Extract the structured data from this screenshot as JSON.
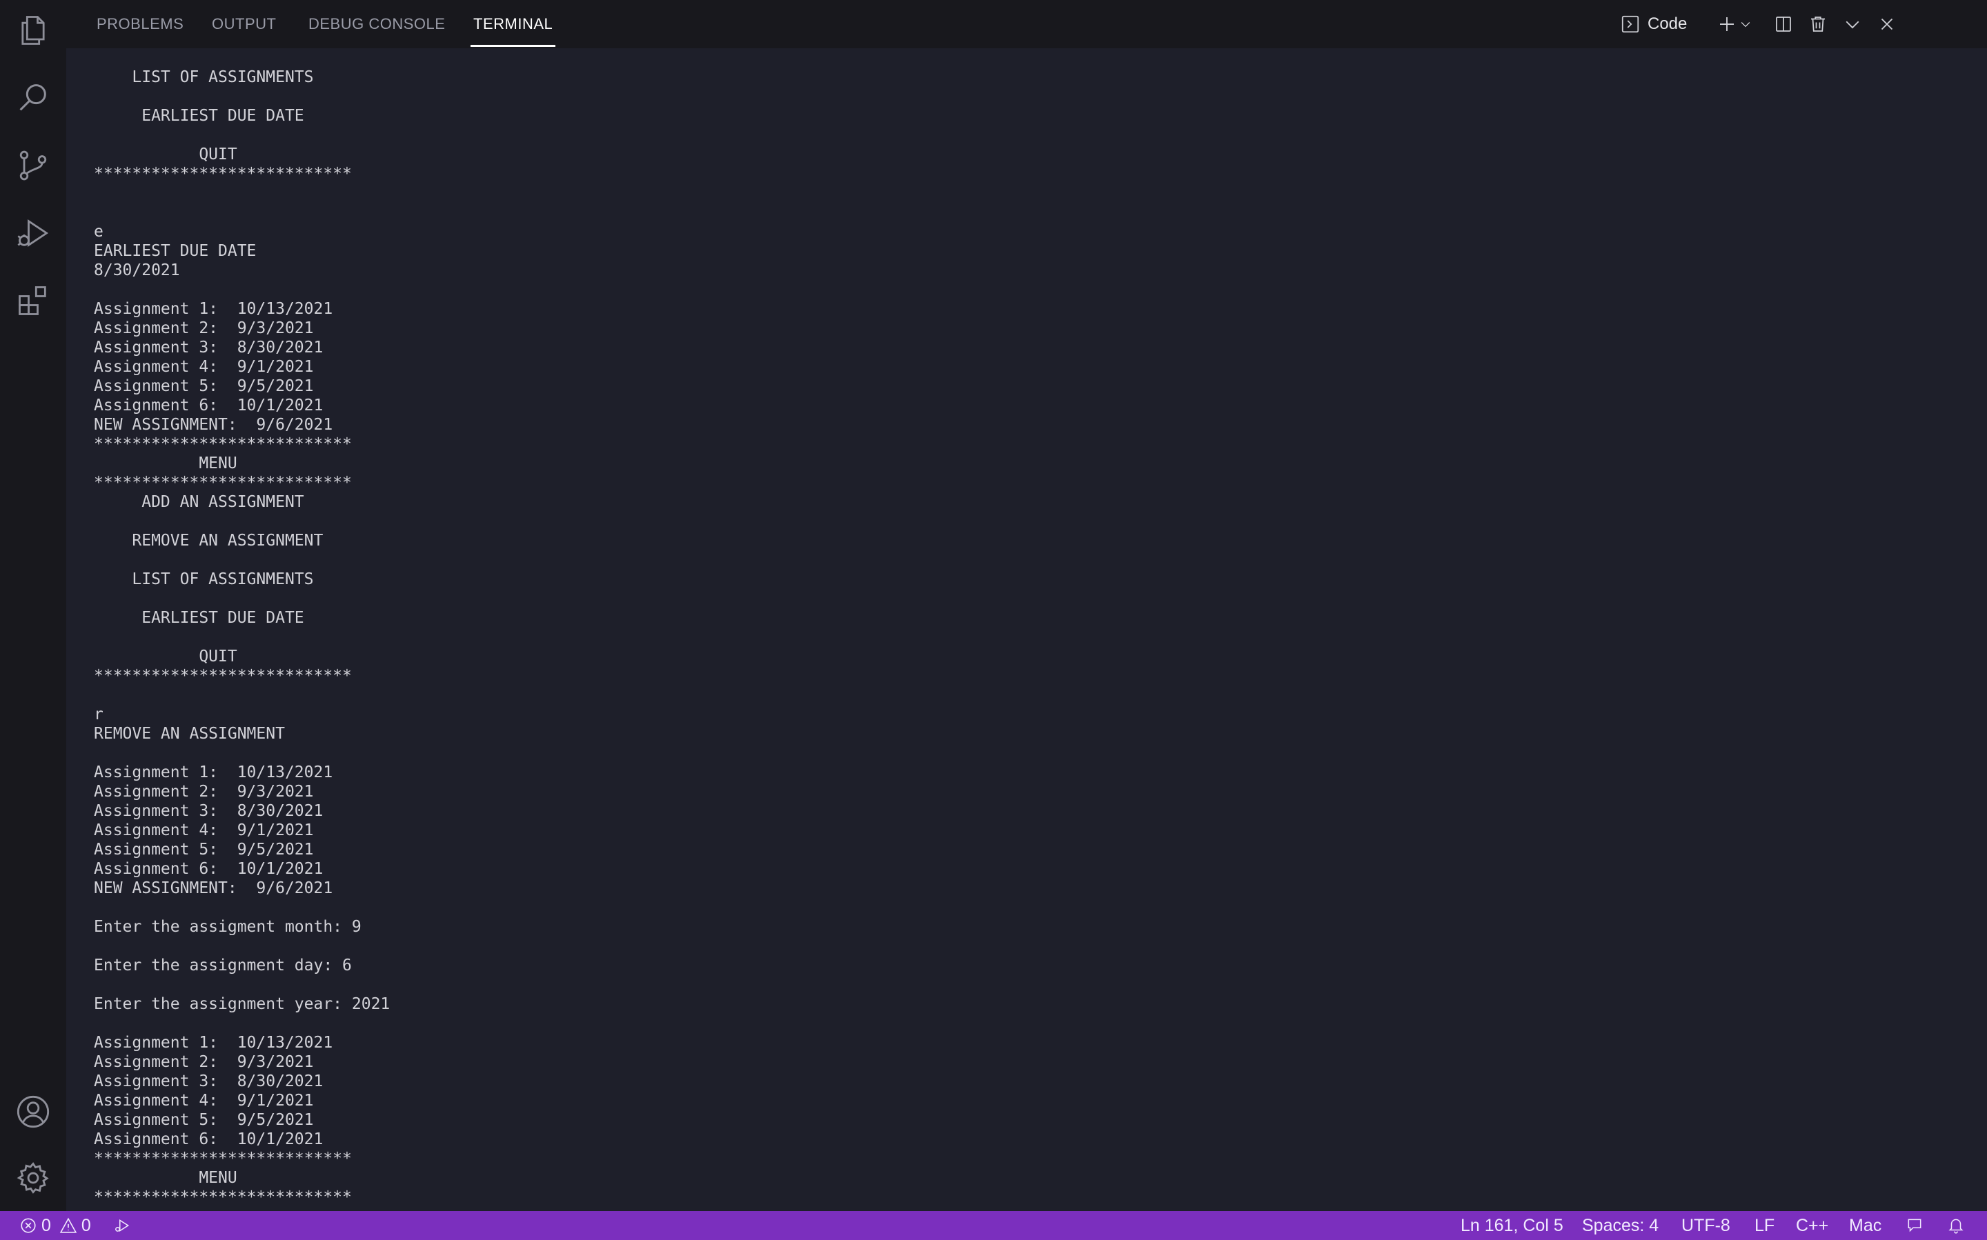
{
  "panel": {
    "tabs": [
      {
        "label": "PROBLEMS"
      },
      {
        "label": "OUTPUT"
      },
      {
        "label": "DEBUG CONSOLE"
      },
      {
        "label": "TERMINAL"
      }
    ],
    "active_tab": "TERMINAL",
    "terminal_label": "Code"
  },
  "activity_bar": {
    "icons": [
      "files-icon",
      "search-icon",
      "source-control-icon",
      "run-debug-icon",
      "extensions-icon",
      "account-icon",
      "settings-gear-icon"
    ]
  },
  "terminal": {
    "lines": [
      "    LIST OF ASSIGNMENTS",
      "",
      "     EARLIEST DUE DATE",
      "",
      "           QUIT",
      "***************************",
      "",
      "",
      "e",
      "EARLIEST DUE DATE",
      "8/30/2021",
      "",
      "Assignment 1:  10/13/2021",
      "Assignment 2:  9/3/2021",
      "Assignment 3:  8/30/2021",
      "Assignment 4:  9/1/2021",
      "Assignment 5:  9/5/2021",
      "Assignment 6:  10/1/2021",
      "NEW ASSIGNMENT:  9/6/2021",
      "***************************",
      "           MENU",
      "***************************",
      "     ADD AN ASSIGNMENT",
      "",
      "    REMOVE AN ASSIGNMENT",
      "",
      "    LIST OF ASSIGNMENTS",
      "",
      "     EARLIEST DUE DATE",
      "",
      "           QUIT",
      "***************************",
      "",
      "r",
      "REMOVE AN ASSIGNMENT",
      "",
      "Assignment 1:  10/13/2021",
      "Assignment 2:  9/3/2021",
      "Assignment 3:  8/30/2021",
      "Assignment 4:  9/1/2021",
      "Assignment 5:  9/5/2021",
      "Assignment 6:  10/1/2021",
      "NEW ASSIGNMENT:  9/6/2021",
      "",
      "Enter the assigment month: 9",
      "",
      "Enter the assignment day: 6",
      "",
      "Enter the assignment year: 2021",
      "",
      "Assignment 1:  10/13/2021",
      "Assignment 2:  9/3/2021",
      "Assignment 3:  8/30/2021",
      "Assignment 4:  9/1/2021",
      "Assignment 5:  9/5/2021",
      "Assignment 6:  10/1/2021",
      "***************************",
      "           MENU",
      "***************************"
    ]
  },
  "status_bar": {
    "errors": "0",
    "warnings": "0",
    "position": "Ln 161, Col 5",
    "spaces": "Spaces: 4",
    "encoding": "UTF-8",
    "eol": "LF",
    "language": "C++",
    "platform": "Mac"
  },
  "colors": {
    "status_bar_bg": "#7b2fbe",
    "terminal_bg": "#1e1f2a",
    "chrome_bg": "#18181d",
    "terminal_fg": "#d2d2d8"
  }
}
